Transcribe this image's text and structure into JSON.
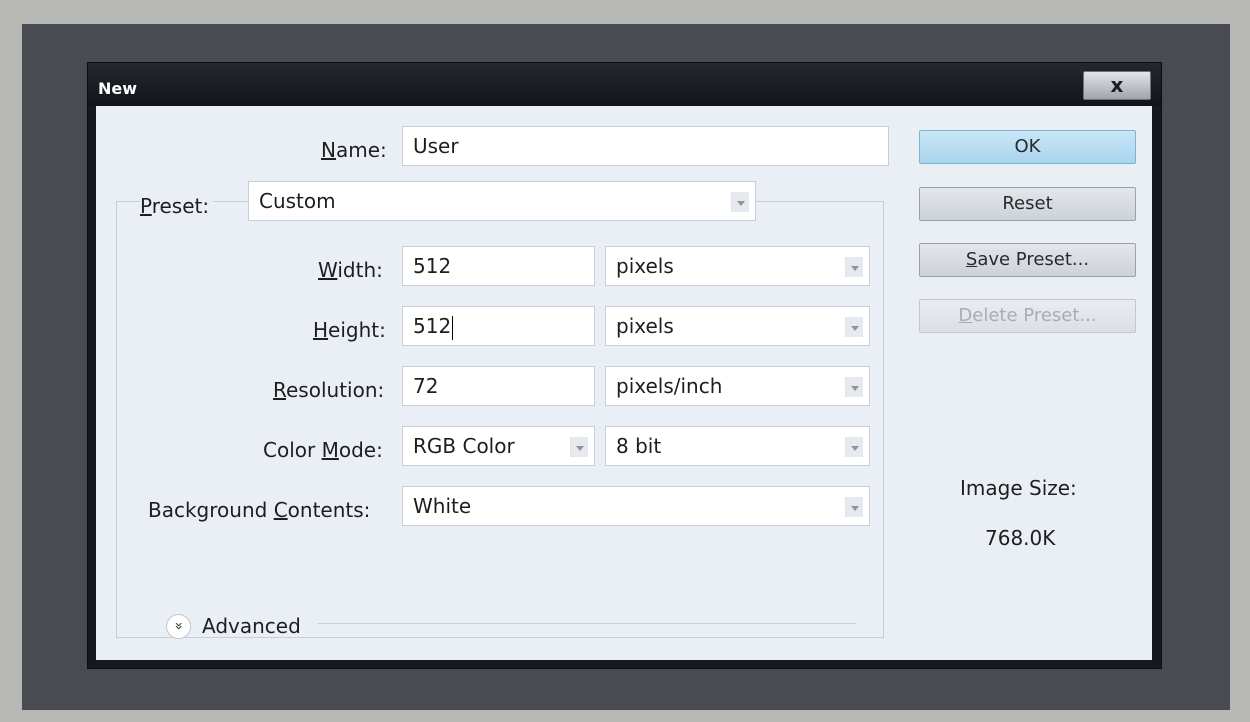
{
  "dialog": {
    "title": "New",
    "close_label": "x"
  },
  "name": {
    "label": "Name:",
    "label_key": "N",
    "label_rest": "ame:",
    "value": "User"
  },
  "preset": {
    "label_key": "P",
    "label_rest": "reset:",
    "value": "Custom"
  },
  "width": {
    "label_key": "W",
    "label_rest": "idth:",
    "value": "512",
    "unit": "pixels"
  },
  "height": {
    "label_pre": "",
    "label_key": "H",
    "label_rest": "eight:",
    "value": "512",
    "unit": "pixels"
  },
  "resolution": {
    "label_key": "R",
    "label_rest": "esolution:",
    "value": "72",
    "unit": "pixels/inch"
  },
  "color_mode": {
    "label_pre": "Color ",
    "label_key": "M",
    "label_rest": "ode:",
    "value": "RGB Color",
    "depth": "8 bit"
  },
  "background": {
    "label_pre": "Background ",
    "label_key": "C",
    "label_rest": "ontents:",
    "value": "White"
  },
  "advanced": {
    "label": "Advanced",
    "icon_glyph": "»"
  },
  "buttons": {
    "ok": "OK",
    "reset": "Reset",
    "save_key": "S",
    "save_rest": "ave Preset...",
    "delete_key": "D",
    "delete_rest": "elete Preset..."
  },
  "image_size": {
    "label": "Image Size:",
    "value": "768.0K"
  },
  "colors": {
    "workspace": "#484c52",
    "dialog_bg": "#eaeff5",
    "ok_accent": "#a9d5ee"
  }
}
